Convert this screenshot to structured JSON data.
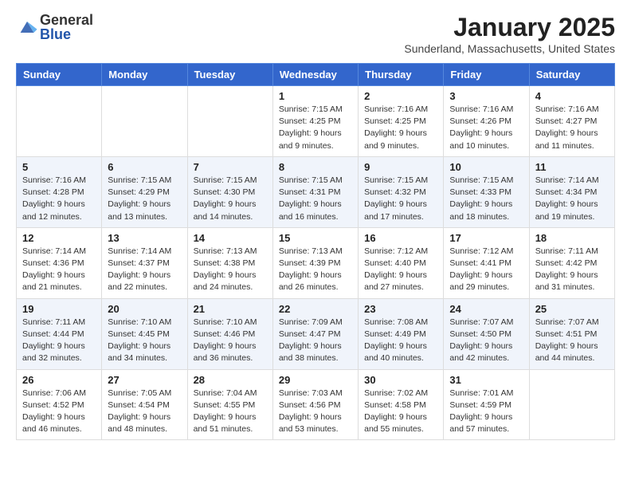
{
  "logo": {
    "general": "General",
    "blue": "Blue"
  },
  "header": {
    "month": "January 2025",
    "location": "Sunderland, Massachusetts, United States"
  },
  "weekdays": [
    "Sunday",
    "Monday",
    "Tuesday",
    "Wednesday",
    "Thursday",
    "Friday",
    "Saturday"
  ],
  "weeks": [
    [
      {
        "day": "",
        "info": ""
      },
      {
        "day": "",
        "info": ""
      },
      {
        "day": "",
        "info": ""
      },
      {
        "day": "1",
        "info": "Sunrise: 7:15 AM\nSunset: 4:25 PM\nDaylight: 9 hours\nand 9 minutes."
      },
      {
        "day": "2",
        "info": "Sunrise: 7:16 AM\nSunset: 4:25 PM\nDaylight: 9 hours\nand 9 minutes."
      },
      {
        "day": "3",
        "info": "Sunrise: 7:16 AM\nSunset: 4:26 PM\nDaylight: 9 hours\nand 10 minutes."
      },
      {
        "day": "4",
        "info": "Sunrise: 7:16 AM\nSunset: 4:27 PM\nDaylight: 9 hours\nand 11 minutes."
      }
    ],
    [
      {
        "day": "5",
        "info": "Sunrise: 7:16 AM\nSunset: 4:28 PM\nDaylight: 9 hours\nand 12 minutes."
      },
      {
        "day": "6",
        "info": "Sunrise: 7:15 AM\nSunset: 4:29 PM\nDaylight: 9 hours\nand 13 minutes."
      },
      {
        "day": "7",
        "info": "Sunrise: 7:15 AM\nSunset: 4:30 PM\nDaylight: 9 hours\nand 14 minutes."
      },
      {
        "day": "8",
        "info": "Sunrise: 7:15 AM\nSunset: 4:31 PM\nDaylight: 9 hours\nand 16 minutes."
      },
      {
        "day": "9",
        "info": "Sunrise: 7:15 AM\nSunset: 4:32 PM\nDaylight: 9 hours\nand 17 minutes."
      },
      {
        "day": "10",
        "info": "Sunrise: 7:15 AM\nSunset: 4:33 PM\nDaylight: 9 hours\nand 18 minutes."
      },
      {
        "day": "11",
        "info": "Sunrise: 7:14 AM\nSunset: 4:34 PM\nDaylight: 9 hours\nand 19 minutes."
      }
    ],
    [
      {
        "day": "12",
        "info": "Sunrise: 7:14 AM\nSunset: 4:36 PM\nDaylight: 9 hours\nand 21 minutes."
      },
      {
        "day": "13",
        "info": "Sunrise: 7:14 AM\nSunset: 4:37 PM\nDaylight: 9 hours\nand 22 minutes."
      },
      {
        "day": "14",
        "info": "Sunrise: 7:13 AM\nSunset: 4:38 PM\nDaylight: 9 hours\nand 24 minutes."
      },
      {
        "day": "15",
        "info": "Sunrise: 7:13 AM\nSunset: 4:39 PM\nDaylight: 9 hours\nand 26 minutes."
      },
      {
        "day": "16",
        "info": "Sunrise: 7:12 AM\nSunset: 4:40 PM\nDaylight: 9 hours\nand 27 minutes."
      },
      {
        "day": "17",
        "info": "Sunrise: 7:12 AM\nSunset: 4:41 PM\nDaylight: 9 hours\nand 29 minutes."
      },
      {
        "day": "18",
        "info": "Sunrise: 7:11 AM\nSunset: 4:42 PM\nDaylight: 9 hours\nand 31 minutes."
      }
    ],
    [
      {
        "day": "19",
        "info": "Sunrise: 7:11 AM\nSunset: 4:44 PM\nDaylight: 9 hours\nand 32 minutes."
      },
      {
        "day": "20",
        "info": "Sunrise: 7:10 AM\nSunset: 4:45 PM\nDaylight: 9 hours\nand 34 minutes."
      },
      {
        "day": "21",
        "info": "Sunrise: 7:10 AM\nSunset: 4:46 PM\nDaylight: 9 hours\nand 36 minutes."
      },
      {
        "day": "22",
        "info": "Sunrise: 7:09 AM\nSunset: 4:47 PM\nDaylight: 9 hours\nand 38 minutes."
      },
      {
        "day": "23",
        "info": "Sunrise: 7:08 AM\nSunset: 4:49 PM\nDaylight: 9 hours\nand 40 minutes."
      },
      {
        "day": "24",
        "info": "Sunrise: 7:07 AM\nSunset: 4:50 PM\nDaylight: 9 hours\nand 42 minutes."
      },
      {
        "day": "25",
        "info": "Sunrise: 7:07 AM\nSunset: 4:51 PM\nDaylight: 9 hours\nand 44 minutes."
      }
    ],
    [
      {
        "day": "26",
        "info": "Sunrise: 7:06 AM\nSunset: 4:52 PM\nDaylight: 9 hours\nand 46 minutes."
      },
      {
        "day": "27",
        "info": "Sunrise: 7:05 AM\nSunset: 4:54 PM\nDaylight: 9 hours\nand 48 minutes."
      },
      {
        "day": "28",
        "info": "Sunrise: 7:04 AM\nSunset: 4:55 PM\nDaylight: 9 hours\nand 51 minutes."
      },
      {
        "day": "29",
        "info": "Sunrise: 7:03 AM\nSunset: 4:56 PM\nDaylight: 9 hours\nand 53 minutes."
      },
      {
        "day": "30",
        "info": "Sunrise: 7:02 AM\nSunset: 4:58 PM\nDaylight: 9 hours\nand 55 minutes."
      },
      {
        "day": "31",
        "info": "Sunrise: 7:01 AM\nSunset: 4:59 PM\nDaylight: 9 hours\nand 57 minutes."
      },
      {
        "day": "",
        "info": ""
      }
    ]
  ]
}
